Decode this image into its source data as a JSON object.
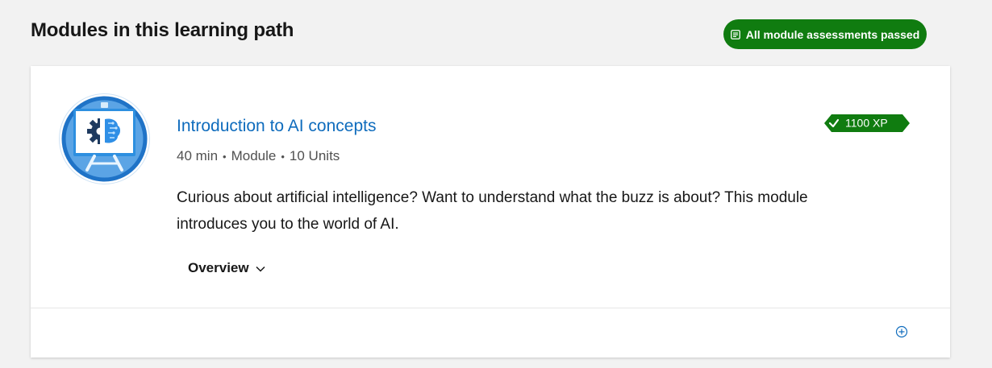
{
  "header": {
    "title": "Modules in this learning path",
    "status_badge": "All module assessments passed"
  },
  "module": {
    "title": "Introduction to AI concepts",
    "duration": "40 min",
    "type": "Module",
    "units": "10 Units",
    "xp": "1100 XP",
    "description": "Curious about artificial intelligence? Want to understand what the buzz is about? This module introduces you to the world of AI.",
    "overview_label": "Overview"
  },
  "colors": {
    "success_green": "#107c10",
    "link_blue": "#0f6cbd",
    "page_bg": "#f2f2f2"
  },
  "icons": {
    "badge_icon": "assessment-icon",
    "xp_icon": "checkmark-icon",
    "overview_icon": "chevron-down-icon",
    "footer_icon": "add-circle-icon",
    "module_icon": "ai-concepts-module-icon"
  }
}
